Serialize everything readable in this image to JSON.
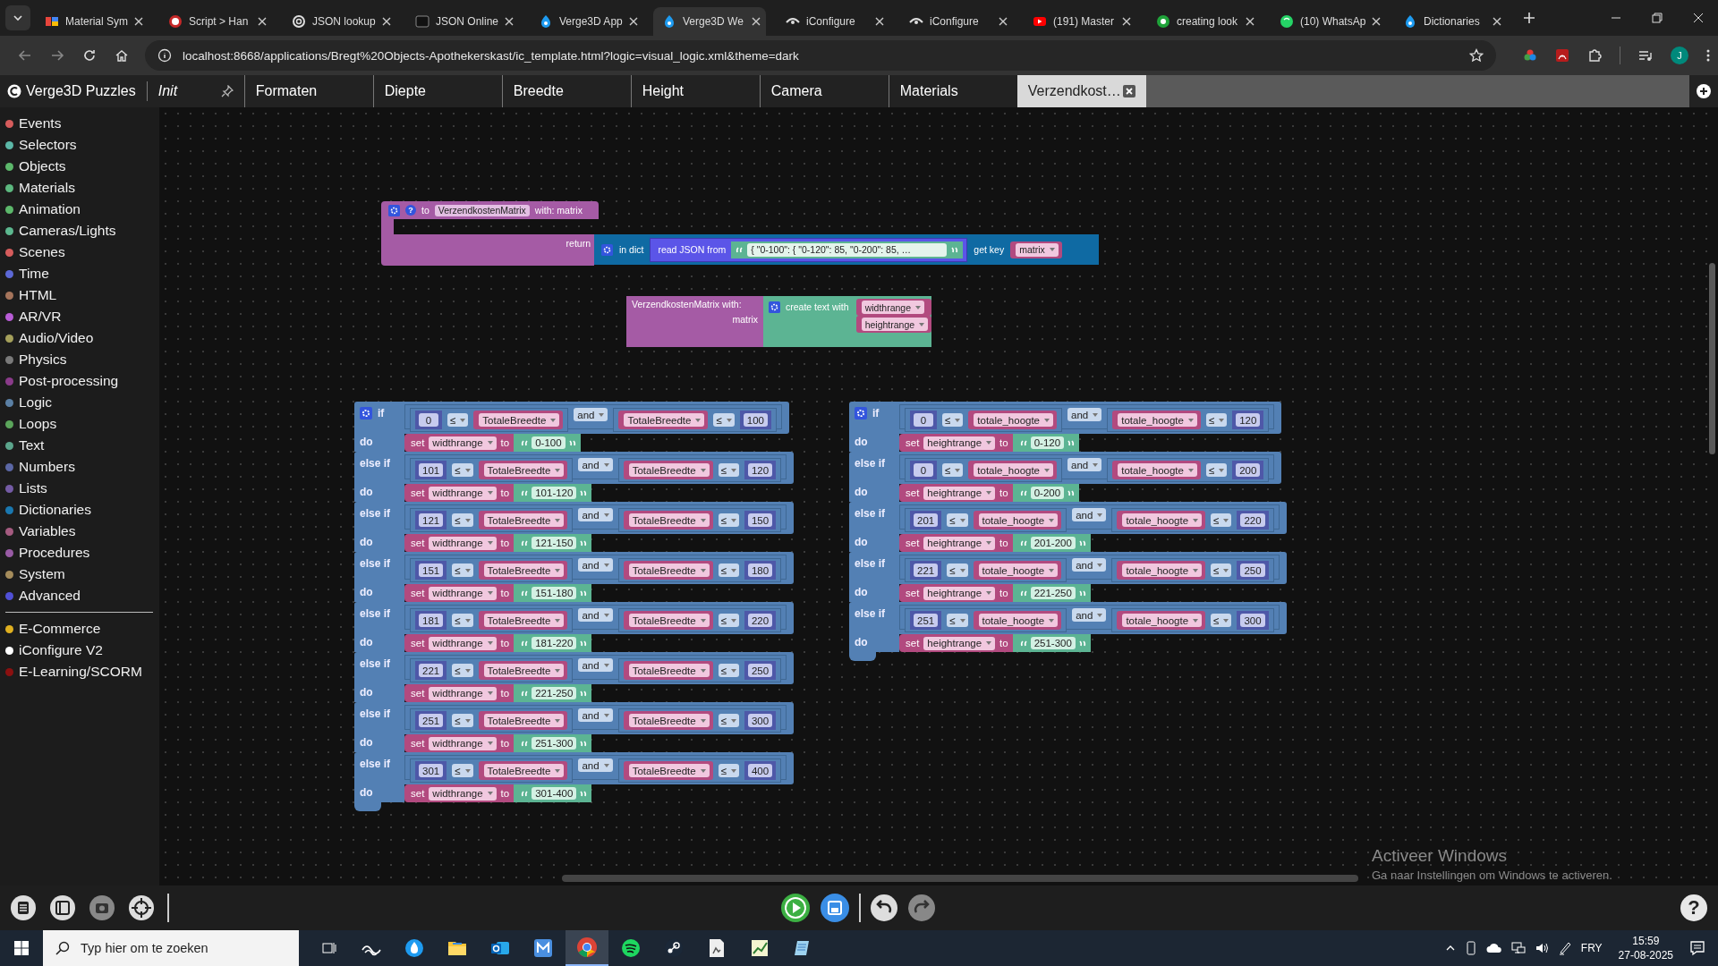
{
  "browser": {
    "tabs": [
      {
        "title": "Material Sym",
        "selected": false
      },
      {
        "title": "Script > Han",
        "selected": false
      },
      {
        "title": "JSON lookup",
        "selected": false
      },
      {
        "title": "JSON Online",
        "selected": false
      },
      {
        "title": "Verge3D App",
        "selected": false
      },
      {
        "title": "Verge3D We",
        "selected": true
      },
      {
        "title": "iConfigure",
        "selected": false
      },
      {
        "title": "iConfigure",
        "selected": false
      },
      {
        "title": "(191) Master",
        "selected": false
      },
      {
        "title": "creating look",
        "selected": false
      },
      {
        "title": "(10) WhatsAp",
        "selected": false
      },
      {
        "title": "Dictionaries",
        "selected": false
      }
    ],
    "address": "localhost:8668/applications/Bregt%20Objects-Apothekerskast/ic_template.html?logic=visual_logic.xml&theme=dark",
    "avatar": "J"
  },
  "puzzles": {
    "logo": "Verge3D Puzzles",
    "tabs": [
      {
        "label": "Init",
        "kind": "init",
        "selected": false
      },
      {
        "label": "Formaten",
        "kind": "normal",
        "selected": false
      },
      {
        "label": "Diepte",
        "kind": "normal",
        "selected": false
      },
      {
        "label": "Breedte",
        "kind": "normal",
        "selected": false
      },
      {
        "label": "Height",
        "kind": "normal",
        "selected": false
      },
      {
        "label": "Camera",
        "kind": "normal",
        "selected": false
      },
      {
        "label": "Materials",
        "kind": "normal",
        "selected": false
      },
      {
        "label": "Verzendkost…",
        "kind": "closable",
        "selected": true
      }
    ]
  },
  "categories": [
    {
      "label": "Events",
      "color": "#d65c5c"
    },
    {
      "label": "Selectors",
      "color": "#5cb8a8"
    },
    {
      "label": "Objects",
      "color": "#5cb86b"
    },
    {
      "label": "Materials",
      "color": "#5cb87f"
    },
    {
      "label": "Animation",
      "color": "#5cb86b"
    },
    {
      "label": "Cameras/Lights",
      "color": "#5cb88f"
    },
    {
      "label": "Scenes",
      "color": "#d65c5c"
    },
    {
      "label": "Time",
      "color": "#5c68d6"
    },
    {
      "label": "HTML",
      "color": "#a5745b"
    },
    {
      "label": "AR/VR",
      "color": "#b85cd6"
    },
    {
      "label": "Audio/Video",
      "color": "#a5a05b"
    },
    {
      "label": "Physics",
      "color": "#7a7a7a"
    },
    {
      "label": "Post-processing",
      "color": "#8a3b8a"
    },
    {
      "label": "Logic",
      "color": "#5b80a5"
    },
    {
      "label": "Loops",
      "color": "#5ba55b"
    },
    {
      "label": "Text",
      "color": "#5ba58c"
    },
    {
      "label": "Numbers",
      "color": "#5b67a5"
    },
    {
      "label": "Lists",
      "color": "#745ba5"
    },
    {
      "label": "Dictionaries",
      "color": "#1a78b0"
    },
    {
      "label": "Variables",
      "color": "#a55b80"
    },
    {
      "label": "Procedures",
      "color": "#995ba5"
    },
    {
      "label": "System",
      "color": "#a58c5b"
    },
    {
      "label": "Advanced",
      "color": "#5050d6"
    }
  ],
  "extra_categories": [
    {
      "label": "E-Commerce",
      "color": "#e0b020"
    },
    {
      "label": "iConfigure V2",
      "color": "#ffffff"
    },
    {
      "label": "E-Learning/SCORM",
      "color": "#8b1010"
    }
  ],
  "procedure": {
    "keyword": "to",
    "help": "?",
    "name": "VerzendkostenMatrix",
    "params": "with: matrix",
    "return": "return",
    "dict": "in dict",
    "read": "read JSON from",
    "json": "{   \"0-100\": {   \"0-120\": 85,   \"0-200\": 85,   …",
    "get_key": "get key",
    "key_var": "matrix"
  },
  "call": {
    "name": "VerzendkostenMatrix  with:",
    "arg": "matrix",
    "create": "create text with",
    "items": [
      "widthrange",
      "heightrange"
    ]
  },
  "if_blocks": [
    {
      "branches": [
        {
          "keyword": "if",
          "low": "0",
          "op_left": "≤",
          "var_left": "TotaleBreedte",
          "logic": "and",
          "var_right": "TotaleBreedte",
          "op_right": "≤",
          "high": "100",
          "do": "do",
          "set": "set",
          "variable": "widthrange",
          "to": "to",
          "value": "0-100"
        },
        {
          "keyword": "else if",
          "low": "101",
          "op_left": "≤",
          "var_left": "TotaleBreedte",
          "logic": "and",
          "var_right": "TotaleBreedte",
          "op_right": "≤",
          "high": "120",
          "do": "do",
          "set": "set",
          "variable": "widthrange",
          "to": "to",
          "value": "101-120"
        },
        {
          "keyword": "else if",
          "low": "121",
          "op_left": "≤",
          "var_left": "TotaleBreedte",
          "logic": "and",
          "var_right": "TotaleBreedte",
          "op_right": "≤",
          "high": "150",
          "do": "do",
          "set": "set",
          "variable": "widthrange",
          "to": "to",
          "value": "121-150"
        },
        {
          "keyword": "else if",
          "low": "151",
          "op_left": "≤",
          "var_left": "TotaleBreedte",
          "logic": "and",
          "var_right": "TotaleBreedte",
          "op_right": "≤",
          "high": "180",
          "do": "do",
          "set": "set",
          "variable": "widthrange",
          "to": "to",
          "value": "151-180"
        },
        {
          "keyword": "else if",
          "low": "181",
          "op_left": "≤",
          "var_left": "TotaleBreedte",
          "logic": "and",
          "var_right": "TotaleBreedte",
          "op_right": "≤",
          "high": "220",
          "do": "do",
          "set": "set",
          "variable": "widthrange",
          "to": "to",
          "value": "181-220"
        },
        {
          "keyword": "else if",
          "low": "221",
          "op_left": "≤",
          "var_left": "TotaleBreedte",
          "logic": "and",
          "var_right": "TotaleBreedte",
          "op_right": "≤",
          "high": "250",
          "do": "do",
          "set": "set",
          "variable": "widthrange",
          "to": "to",
          "value": "221-250"
        },
        {
          "keyword": "else if",
          "low": "251",
          "op_left": "≤",
          "var_left": "TotaleBreedte",
          "logic": "and",
          "var_right": "TotaleBreedte",
          "op_right": "≤",
          "high": "300",
          "do": "do",
          "set": "set",
          "variable": "widthrange",
          "to": "to",
          "value": "251-300"
        },
        {
          "keyword": "else if",
          "low": "301",
          "op_left": "≤",
          "var_left": "TotaleBreedte",
          "logic": "and",
          "var_right": "TotaleBreedte",
          "op_right": "≤",
          "high": "400",
          "do": "do",
          "set": "set",
          "variable": "widthrange",
          "to": "to",
          "value": "301-400"
        }
      ]
    },
    {
      "branches": [
        {
          "keyword": "if",
          "low": "0",
          "op_left": "≤",
          "var_left": "totale_hoogte",
          "logic": "and",
          "var_right": "totale_hoogte",
          "op_right": "≤",
          "high": "120",
          "do": "do",
          "set": "set",
          "variable": "heightrange",
          "to": "to",
          "value": "0-120"
        },
        {
          "keyword": "else if",
          "low": "0",
          "op_left": "≤",
          "var_left": "totale_hoogte",
          "logic": "and",
          "var_right": "totale_hoogte",
          "op_right": "≤",
          "high": "200",
          "do": "do",
          "set": "set",
          "variable": "heightrange",
          "to": "to",
          "value": "0-200"
        },
        {
          "keyword": "else if",
          "low": "201",
          "op_left": "≤",
          "var_left": "totale_hoogte",
          "logic": "and",
          "var_right": "totale_hoogte",
          "op_right": "≤",
          "high": "220",
          "do": "do",
          "set": "set",
          "variable": "heightrange",
          "to": "to",
          "value": "201-200"
        },
        {
          "keyword": "else if",
          "low": "221",
          "op_left": "≤",
          "var_left": "totale_hoogte",
          "logic": "and",
          "var_right": "totale_hoogte",
          "op_right": "≤",
          "high": "250",
          "do": "do",
          "set": "set",
          "variable": "heightrange",
          "to": "to",
          "value": "221-250"
        },
        {
          "keyword": "else if",
          "low": "251",
          "op_left": "≤",
          "var_left": "totale_hoogte",
          "logic": "and",
          "var_right": "totale_hoogte",
          "op_right": "≤",
          "high": "300",
          "do": "do",
          "set": "set",
          "variable": "heightrange",
          "to": "to",
          "value": "251-300"
        }
      ]
    }
  ],
  "toolbar": {
    "help": "?"
  },
  "watermark": {
    "title": "Activeer Windows",
    "subtitle": "Ga naar Instellingen om Windows te activeren."
  },
  "taskbar": {
    "search_placeholder": "Typ hier om te zoeken",
    "language": "FRY",
    "time": "15:59",
    "date": "27-08-2025"
  }
}
